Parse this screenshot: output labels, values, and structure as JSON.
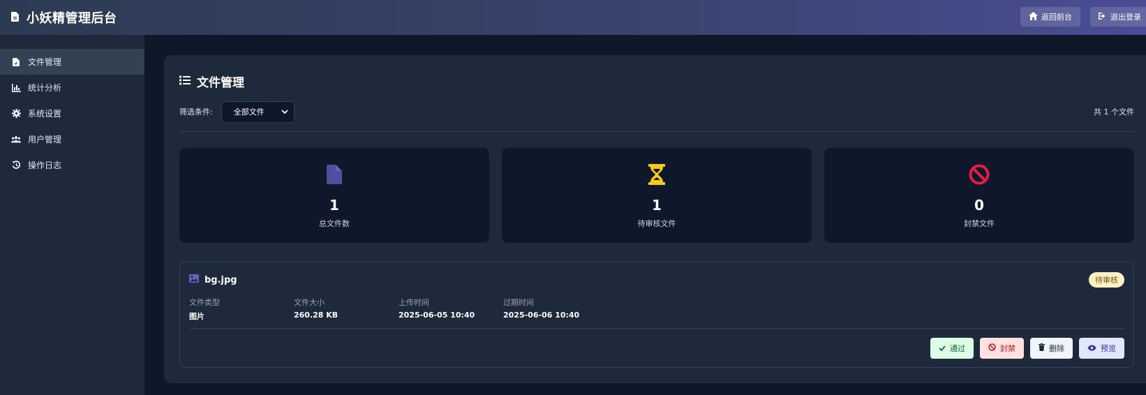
{
  "header": {
    "title": "小妖精管理后台",
    "home_button": "返回前台",
    "logout_button": "退出登录"
  },
  "sidebar": {
    "items": [
      {
        "label": "文件管理",
        "icon": "file-icon",
        "active": true
      },
      {
        "label": "统计分析",
        "icon": "chart-icon",
        "active": false
      },
      {
        "label": "系统设置",
        "icon": "gear-icon",
        "active": false
      },
      {
        "label": "用户管理",
        "icon": "users-icon",
        "active": false
      },
      {
        "label": "操作日志",
        "icon": "history-icon",
        "active": false
      }
    ]
  },
  "main": {
    "title": "文件管理",
    "filter_label": "筛选条件:",
    "filter_value": "全部文件",
    "file_count": "共 1 个文件",
    "stats": [
      {
        "value": "1",
        "label": "总文件数",
        "icon": "file-icon",
        "color": "#4f4f9e"
      },
      {
        "value": "1",
        "label": "待审核文件",
        "icon": "hourglass-icon",
        "color": "#facc15"
      },
      {
        "value": "0",
        "label": "封禁文件",
        "icon": "ban-icon",
        "color": "#e11d48"
      }
    ],
    "file": {
      "name": "bg.jpg",
      "status": "待审核",
      "meta": [
        {
          "label": "文件类型",
          "value": "图片"
        },
        {
          "label": "文件大小",
          "value": "260.28 KB"
        },
        {
          "label": "上传时间",
          "value": "2025-06-05 10:40"
        },
        {
          "label": "过期时间",
          "value": "2025-06-06 10:40"
        }
      ],
      "actions": {
        "approve": "通过",
        "ban": "封禁",
        "delete": "删除",
        "preview": "预览"
      }
    }
  },
  "colors": {
    "background": "#0f172a",
    "panel": "#1e293b",
    "accent": "#4a4d95",
    "pending_badge": "#fef3c7"
  }
}
